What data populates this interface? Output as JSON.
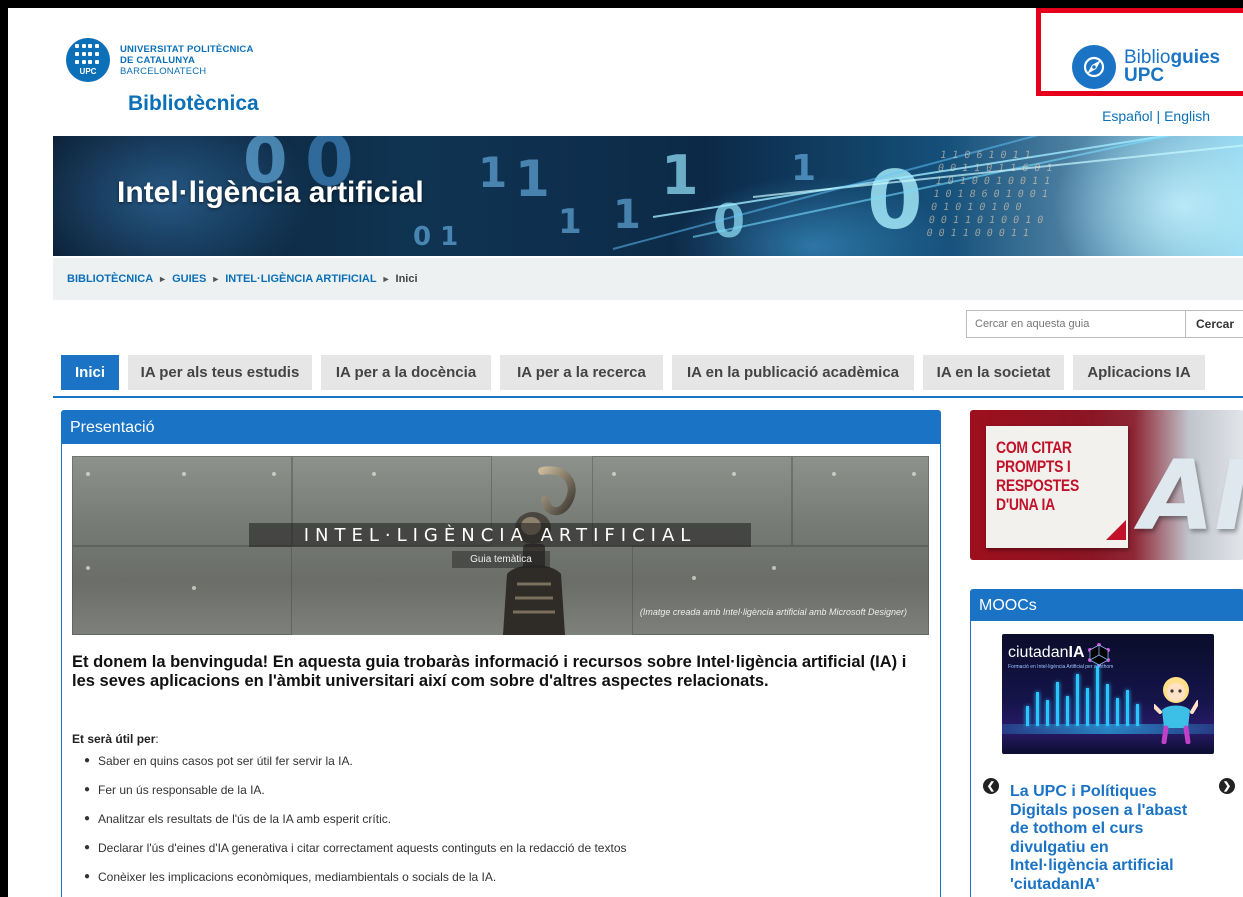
{
  "header": {
    "university_lines": [
      "UNIVERSITAT POLITÈCNICA",
      "DE CATALUNYA",
      "BARCELONATECH"
    ],
    "university_logo_text": "UPC",
    "site_title": "Bibliotècnica",
    "biblioguies": {
      "prefix": "Biblio",
      "bold": "guies",
      "line2": "UPC"
    },
    "languages": "Español | English"
  },
  "banner": {
    "title": "Intel·ligència artificial"
  },
  "breadcrumb": {
    "items": [
      "BIBLIOTÈCNICA",
      "GUIES",
      "INTEL·LIGÈNCIA ARTIFICIAL"
    ],
    "current": "Inici",
    "separator": "►"
  },
  "search": {
    "placeholder": "Cercar en aquesta guia",
    "button": "Cercar"
  },
  "tabs": [
    {
      "label": "Inici",
      "active": true
    },
    {
      "label": "IA per als teus estudis"
    },
    {
      "label": "IA per a la docència"
    },
    {
      "label": "IA per a la recerca"
    },
    {
      "label": "IA en la publicació acadèmica"
    },
    {
      "label": "IA en la societat"
    },
    {
      "label": "Aplicacions IA"
    }
  ],
  "presentation": {
    "heading": "Presentació",
    "image_title": "INTEL·LIGÈNCIA ARTIFICIAL",
    "image_subtitle": "Guia temàtica",
    "image_caption": "(Imatge creada amb Intel·ligència artificial amb Microsoft Designer)",
    "welcome": "Et donem la benvinguda! En aquesta guia trobaràs informació i recursos sobre Intel·ligència artificial (IA) i les seves aplicacions en l'àmbit universitari així com sobre d'altres aspectes relacionats.",
    "useful_label": "Et serà útil per",
    "useful_colon": ":",
    "useful_items": [
      "Saber en quins casos pot ser útil fer servir la IA.",
      "Fer un ús responsable de la IA.",
      "Analitzar els resultats de l'ús de la IA amb esperit crític.",
      "Declarar l'ús d'eines d'IA generativa i citar correctament aquests continguts en la redacció de textos",
      "Conèixer les implicacions econòmiques, mediambientals o socials de la IA."
    ]
  },
  "cite_card": {
    "lines": [
      "COM CITAR",
      "PROMPTS I",
      "RESPOSTES",
      "D'UNA IA"
    ],
    "ai": "AI"
  },
  "moocs": {
    "heading": "MOOCs",
    "image_brand_prefix": "ciutadan",
    "image_brand_bold": "IA",
    "image_tagline": "Formació en Intel·ligència Artificial per a tothom",
    "headline": "La UPC i Polítiques Digitals posen a l'abast de tothom el curs divulgatiu en Intel·ligència artificial 'ciutadanIA'",
    "prev_icon": "chevron-left-circle-icon",
    "next_icon": "chevron-right-circle-icon"
  },
  "colors": {
    "upc_blue": "#0b70b7",
    "tab_blue": "#1a73c4",
    "highlight_red": "#e4001b",
    "cite_red": "#c2122a"
  }
}
